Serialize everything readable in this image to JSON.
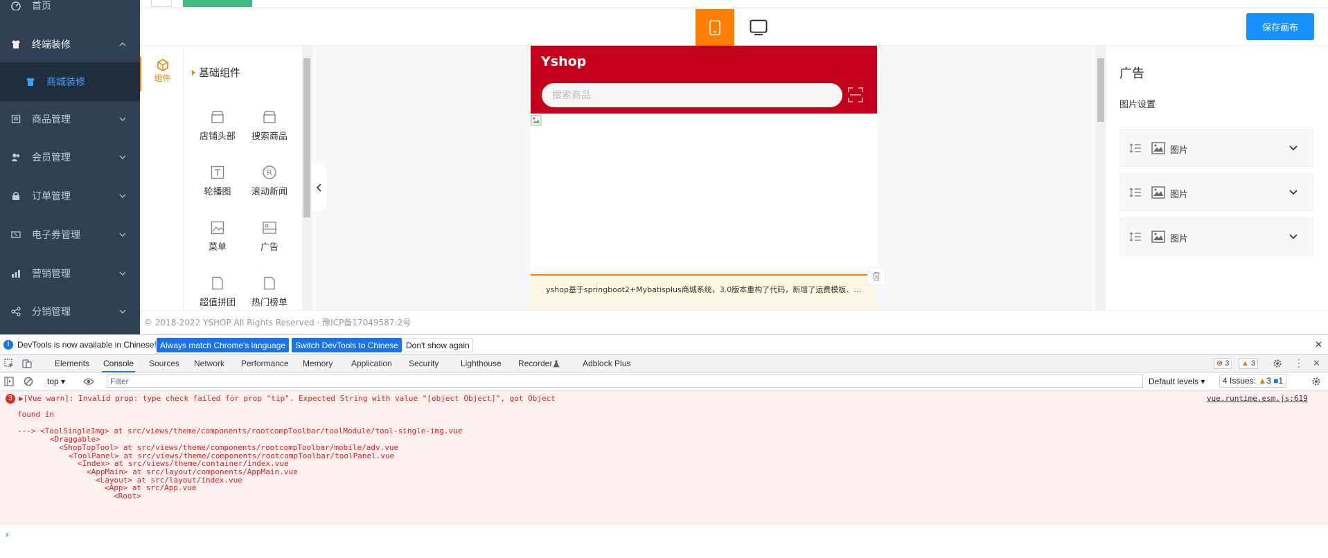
{
  "sidebar": {
    "items": [
      {
        "label": "首页",
        "icon": "dashboard-icon"
      },
      {
        "label": "终端装修",
        "icon": "shirt-icon"
      },
      {
        "label": "商城装修",
        "icon": "shirt-icon"
      },
      {
        "label": "商品管理",
        "icon": "goods-icon"
      },
      {
        "label": "会员管理",
        "icon": "members-icon"
      },
      {
        "label": "订单管理",
        "icon": "lock-icon"
      },
      {
        "label": "电子券管理",
        "icon": "coupon-icon"
      },
      {
        "label": "营销管理",
        "icon": "chart-icon"
      },
      {
        "label": "分销管理",
        "icon": "share-icon"
      }
    ]
  },
  "colors": {
    "sidebar_bg": "#304156",
    "accent_orange": "#ff7d00",
    "brand_red": "#c4001a",
    "primary_blue": "#1890ff"
  },
  "toolbar": {
    "save_label": "保存画布",
    "mobile_icon": "mobile-icon",
    "pc_icon": "monitor-icon"
  },
  "components": {
    "tab_label": "组件",
    "section_title": "基础组件",
    "items": [
      {
        "label": "店铺头部",
        "icon": "store-icon"
      },
      {
        "label": "搜索商品",
        "icon": "store-icon"
      },
      {
        "label": "轮播图",
        "icon": "text-box-icon"
      },
      {
        "label": "滚动新闻",
        "icon": "registered-icon"
      },
      {
        "label": "菜单",
        "icon": "picture-icon"
      },
      {
        "label": "广告",
        "icon": "ad-icon"
      },
      {
        "label": "超值拼团",
        "icon": "file-icon"
      },
      {
        "label": "热门榜单",
        "icon": "file-icon"
      }
    ]
  },
  "phone": {
    "shop_name": "Yshop",
    "search_placeholder": "搜索商品",
    "news_text": "yshop基于springboot2+Mybatisplus商城系统，3.0版本重构了代码，新增了运费模板、…"
  },
  "settings": {
    "title": "广告",
    "subtitle": "图片设置",
    "image_rows": [
      {
        "label": "图片"
      },
      {
        "label": "图片"
      },
      {
        "label": "图片"
      }
    ]
  },
  "footer": {
    "text": "© 2018-2022 YSHOP All Rights Reserved · 豫ICP备17049587-2号"
  },
  "devtools": {
    "info_text": "DevTools is now available in Chinese!",
    "btn_match": "Always match Chrome's language",
    "btn_switch": "Switch DevTools to Chinese",
    "btn_dont_show": "Don't show again",
    "tabs": [
      "Elements",
      "Console",
      "Sources",
      "Network",
      "Performance",
      "Memory",
      "Application",
      "Security",
      "Lighthouse",
      "Recorder",
      "Adblock Plus"
    ],
    "errors_count": "3",
    "warnings_count": "3",
    "context": "top",
    "filter_placeholder": "Filter",
    "levels": "Default levels",
    "issues_label": "4 Issues:",
    "issues_warn": "3",
    "issues_info": "1",
    "log": {
      "count": "3",
      "source": "vue.runtime.esm.js:619",
      "lines": [
        "▶[Vue warn]: Invalid prop: type check failed for prop \"tip\". Expected String with value \"[object Object]\", got Object",
        "found in",
        "---> <ToolSingleImg> at src/views/theme/components/rootcompToolbar/toolModule/tool-single-img.vue",
        "<Draggable>",
        "<ShopTopTool> at src/views/theme/components/rootcompToolbar/mobile/adv.vue",
        "<ToolPanel> at src/views/theme/components/rootcompToolbar/toolPanel.vue",
        "<Index> at src/views/theme/container/index.vue",
        "<AppMain> at src/layout/components/AppMain.vue",
        "<Layout> at src/layout/index.vue",
        "<App> at src/App.vue",
        "<Root>"
      ]
    },
    "prompt": "›"
  }
}
